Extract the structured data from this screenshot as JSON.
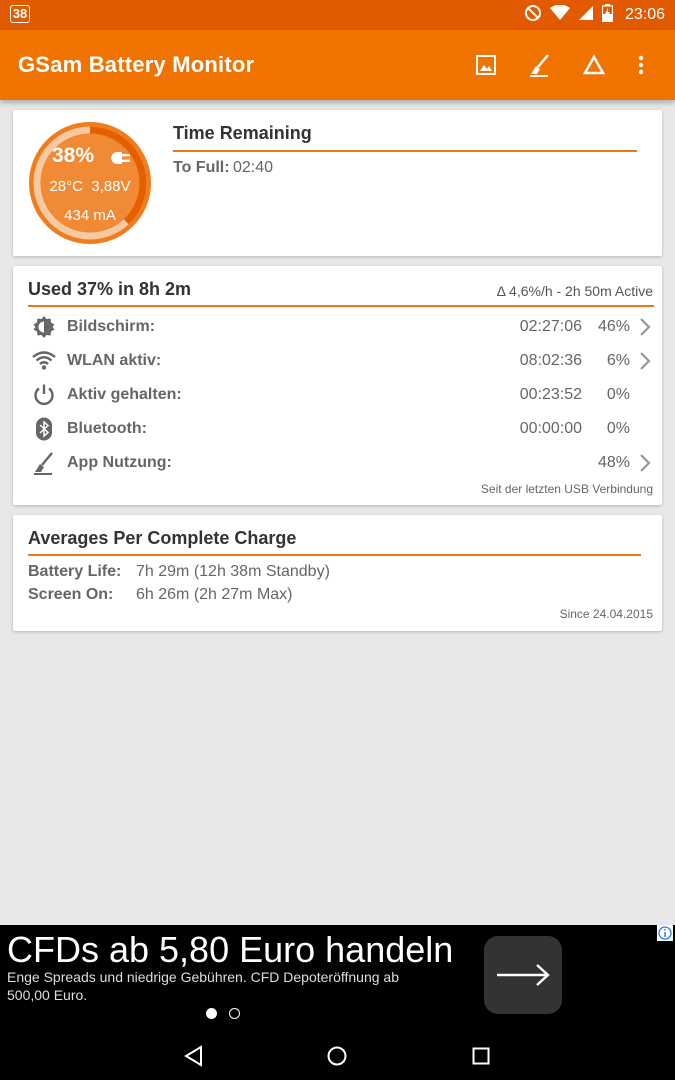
{
  "status_bar": {
    "notification_badge": "38",
    "time": "23:06",
    "icons": [
      "do-not-disturb-icon",
      "wifi-icon",
      "signal-icon",
      "battery-charging-icon"
    ]
  },
  "app_bar": {
    "title": "GSam Battery Monitor",
    "actions": [
      "image-icon",
      "broom-icon",
      "delta-icon",
      "overflow-menu-icon"
    ]
  },
  "battery_card": {
    "percent": "38%",
    "charge_fraction": 0.38,
    "temp_voltage": "28°C  3,88V",
    "current": "434 mA",
    "title": "Time Remaining",
    "to_full_label": "To Full:",
    "to_full_value": "02:40"
  },
  "usage_card": {
    "title": "Used 37% in 8h 2m",
    "rate": "Δ 4,6%/h - 2h 50m Active",
    "rows": [
      {
        "icon": "brightness-icon",
        "label": "Bildschirm:",
        "time": "02:27:06",
        "percent": "46%",
        "chevron": true
      },
      {
        "icon": "wifi-icon",
        "label": "WLAN aktiv:",
        "time": "08:02:36",
        "percent": "6%",
        "chevron": true
      },
      {
        "icon": "power-icon",
        "label": "Aktiv gehalten:",
        "time": "00:23:52",
        "percent": "0%",
        "chevron": false
      },
      {
        "icon": "bluetooth-icon",
        "label": "Bluetooth:",
        "time": "00:00:00",
        "percent": "0%",
        "chevron": false
      },
      {
        "icon": "broom-icon",
        "label": "App Nutzung:",
        "time": "",
        "percent": "48%",
        "chevron": true
      }
    ],
    "footnote": "Seit der letzten USB Verbindung"
  },
  "averages_card": {
    "title": "Averages Per Complete Charge",
    "battery_life_label": "Battery Life:",
    "battery_life_value": "7h 29m (12h 38m Standby)",
    "screen_on_label": "Screen On:",
    "screen_on_value": "6h 26m (2h 27m Max)",
    "since": "Since 24.04.2015"
  },
  "ad": {
    "title": "CFDs ab 5,80 Euro handeln",
    "text": "Enge Spreads und niedrige Gebühren. CFD Depoteröffnung ab 500,00 Euro.",
    "pages": 2,
    "active_page": 1
  },
  "nav_bar": [
    "back-icon",
    "home-icon",
    "recents-icon"
  ],
  "colors": {
    "status_bar": "#e25a00",
    "app_bar": "#f07300",
    "accent": "#e8781a",
    "background": "#e8e8e8"
  }
}
